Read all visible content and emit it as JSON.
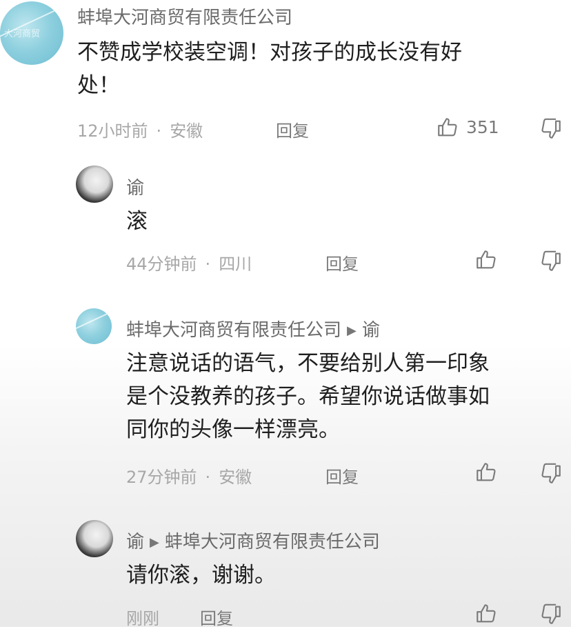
{
  "comments": [
    {
      "username": "蚌埠大河商贸有限责任公司",
      "content": "不赞成学校装空调！对孩子的成长没有好\n处！",
      "time": "12小时前",
      "location": "安徽",
      "reply_label": "回复",
      "likes": "351",
      "avatar_text": "大河商贸"
    },
    {
      "username": "谕",
      "content": "滚",
      "time": "44分钟前",
      "location": "四川",
      "reply_label": "回复"
    },
    {
      "username": "蚌埠大河商贸有限责任公司",
      "reply_to": "谕",
      "content": "注意说话的语气，不要给别人第一印象\n是个没教养的孩子。希望你说话做事如\n同你的头像一样漂亮。",
      "time": "27分钟前",
      "location": "安徽",
      "reply_label": "回复"
    },
    {
      "username": "谕",
      "reply_to": "蚌埠大河商贸有限责任公司",
      "content": "请你滚，谢谢。",
      "time": "刚刚",
      "reply_label": "回复"
    }
  ],
  "icons": {
    "like": "thumbs-up-icon",
    "dislike": "thumbs-down-icon",
    "reply_arrow": "▶"
  },
  "colors": {
    "company_avatar": "#8fd0df",
    "text": "#1f1f1f",
    "meta": "#a7a7a7"
  }
}
